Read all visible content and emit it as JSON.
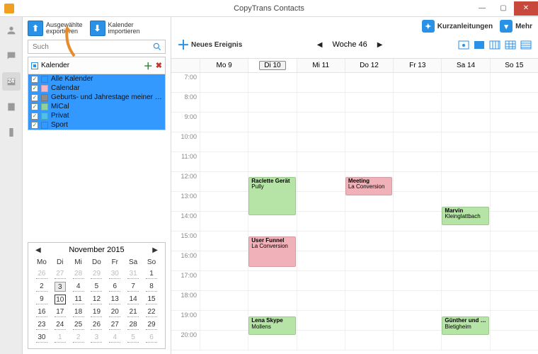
{
  "window": {
    "title": "CopyTrans Contacts"
  },
  "rail": {
    "calendar_badge": "24"
  },
  "toolbar": {
    "export_l1": "Ausgewählte",
    "export_l2": "exportieren",
    "import_l1": "Kalender",
    "import_l2": "importieren",
    "guides": "Kurzanleitungen",
    "more": "Mehr"
  },
  "search": {
    "placeholder": "Such"
  },
  "calendars": {
    "header": "Kalender",
    "items": [
      {
        "label": "Alle Kalender",
        "color": "#3399ff"
      },
      {
        "label": "Calendar",
        "color": "#f5b7c6"
      },
      {
        "label": "Geburts- und Jahrestage meiner Konta…",
        "color": "#8c8c8c"
      },
      {
        "label": "MiCal",
        "color": "#8fd19e"
      },
      {
        "label": "Privat",
        "color": "#4fc1e9"
      },
      {
        "label": "Sport",
        "color": "#3399ff"
      }
    ]
  },
  "minical": {
    "month": "November 2015",
    "dow": [
      "Mo",
      "Di",
      "Mi",
      "Do",
      "Fr",
      "Sa",
      "So"
    ],
    "rows": [
      [
        {
          "d": "26",
          "o": 1
        },
        {
          "d": "27",
          "o": 1
        },
        {
          "d": "28",
          "o": 1
        },
        {
          "d": "29",
          "o": 1
        },
        {
          "d": "30",
          "o": 1
        },
        {
          "d": "31",
          "o": 1
        },
        {
          "d": "1"
        }
      ],
      [
        {
          "d": "2"
        },
        {
          "d": "3",
          "today": 1
        },
        {
          "d": "4"
        },
        {
          "d": "5"
        },
        {
          "d": "6"
        },
        {
          "d": "7"
        },
        {
          "d": "8"
        }
      ],
      [
        {
          "d": "9"
        },
        {
          "d": "10",
          "sel": 1
        },
        {
          "d": "11"
        },
        {
          "d": "12"
        },
        {
          "d": "13"
        },
        {
          "d": "14"
        },
        {
          "d": "15"
        }
      ],
      [
        {
          "d": "16"
        },
        {
          "d": "17"
        },
        {
          "d": "18"
        },
        {
          "d": "19"
        },
        {
          "d": "20"
        },
        {
          "d": "21"
        },
        {
          "d": "22"
        }
      ],
      [
        {
          "d": "23"
        },
        {
          "d": "24"
        },
        {
          "d": "25"
        },
        {
          "d": "26"
        },
        {
          "d": "27"
        },
        {
          "d": "28"
        },
        {
          "d": "29"
        }
      ],
      [
        {
          "d": "30"
        },
        {
          "d": "1",
          "o": 1
        },
        {
          "d": "2",
          "o": 1
        },
        {
          "d": "3",
          "o": 1
        },
        {
          "d": "4",
          "o": 1
        },
        {
          "d": "5",
          "o": 1
        },
        {
          "d": "6",
          "o": 1
        }
      ]
    ]
  },
  "main": {
    "new_event": "Neues Ereignis",
    "week_label": "Woche 46",
    "days": [
      "Mo 9",
      "Di 10",
      "Mi 11",
      "Do 12",
      "Fr 13",
      "Sa 14",
      "So 15"
    ],
    "active_day_index": 1,
    "startHour": 7,
    "endHour": 20,
    "events": [
      {
        "day": 1,
        "hour": 12.25,
        "len": 2,
        "title": "Raclette Gerät",
        "loc": "Pully",
        "color": "#b6e3a6"
      },
      {
        "day": 3,
        "hour": 12.25,
        "len": 1,
        "title": "Meeting",
        "loc": "La Conversion",
        "color": "#f0b2b8"
      },
      {
        "day": 5,
        "hour": 13.75,
        "len": 1,
        "title": "Marvin",
        "loc": "Kleinglattbach",
        "color": "#b6e3a6"
      },
      {
        "day": 1,
        "hour": 15.25,
        "len": 1.6,
        "title": "User Funnel",
        "loc": "La Conversion",
        "color": "#f0b2b8"
      },
      {
        "day": 1,
        "hour": 19.3,
        "len": 1,
        "title": "Lena Skype",
        "loc": "Mollens",
        "color": "#b6e3a6"
      },
      {
        "day": 5,
        "hour": 19.3,
        "len": 1,
        "title": "Günther und …",
        "loc": "Bietigheim",
        "color": "#b6e3a6"
      }
    ]
  }
}
